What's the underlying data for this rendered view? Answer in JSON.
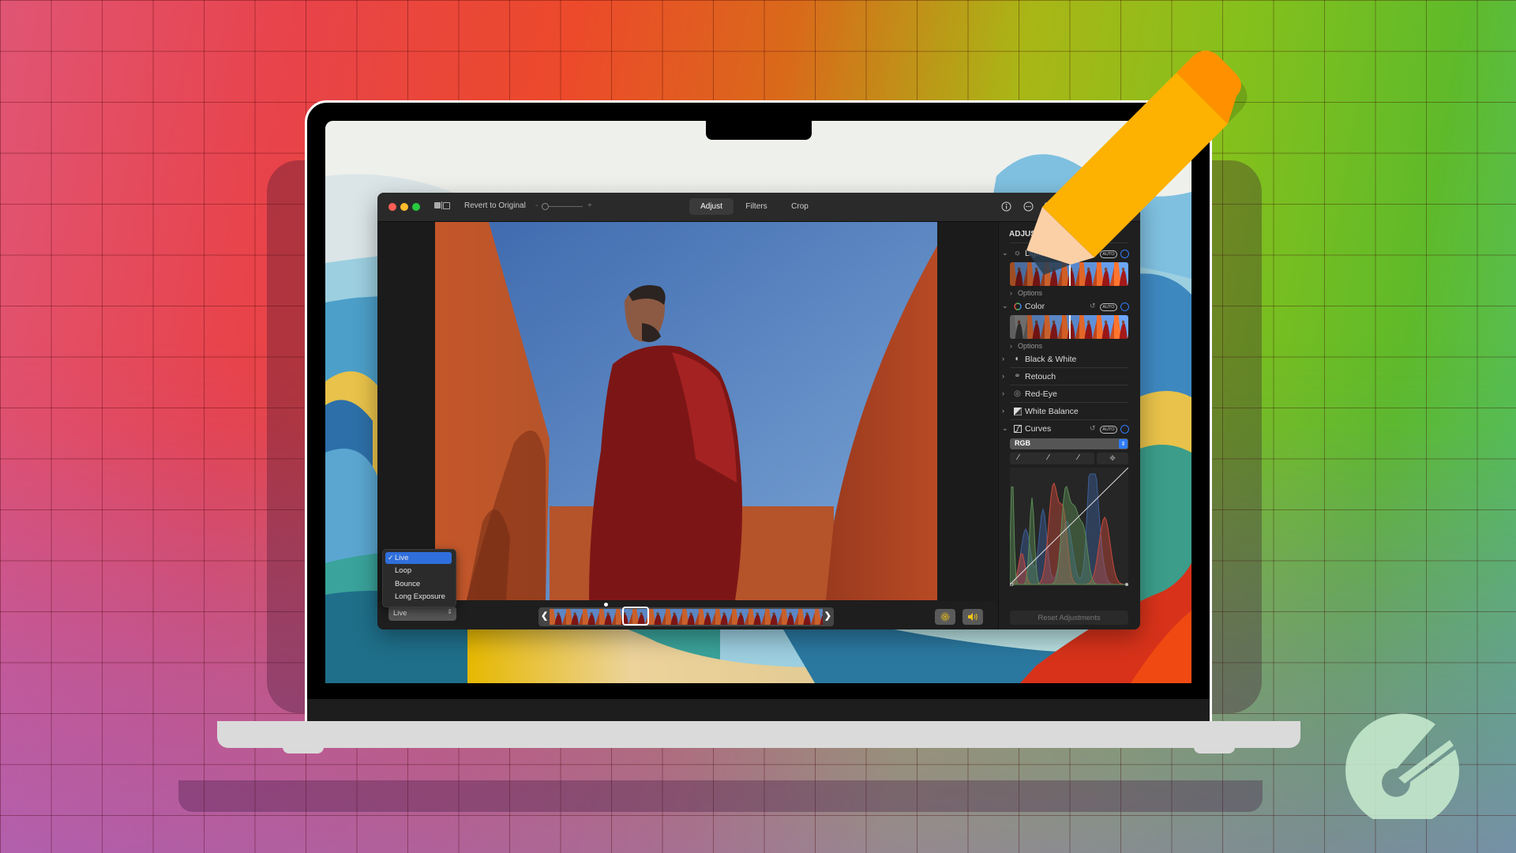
{
  "window": {
    "revert_label": "Revert to Original",
    "zoom_minus": "-",
    "zoom_plus": "+",
    "tabs": [
      {
        "label": "Adjust",
        "active": true
      },
      {
        "label": "Filters",
        "active": false
      },
      {
        "label": "Crop",
        "active": false
      }
    ],
    "toolbar_icons": [
      "info-icon",
      "more-icon",
      "heart-icon"
    ]
  },
  "adjust_panel": {
    "title": "ADJUST",
    "sections": [
      {
        "label": "Light",
        "expanded": true,
        "icon": "sun-icon",
        "has_auto": true,
        "options_label": "Options"
      },
      {
        "label": "Color",
        "expanded": true,
        "icon": "color-wheel-icon",
        "has_auto": true,
        "options_label": "Options"
      },
      {
        "label": "Black & White",
        "expanded": false,
        "icon": "half-circle-icon"
      },
      {
        "label": "Retouch",
        "expanded": false,
        "icon": "bandage-icon"
      },
      {
        "label": "Red-Eye",
        "expanded": false,
        "icon": "eye-icon"
      },
      {
        "label": "White Balance",
        "expanded": false,
        "icon": "white-balance-icon"
      },
      {
        "label": "Curves",
        "expanded": true,
        "icon": "curves-icon",
        "has_auto": true
      }
    ],
    "auto_label": "AUTO",
    "curves_channel": "RGB",
    "reset_label": "Reset Adjustments"
  },
  "live_menu": {
    "options": [
      "Live",
      "Loop",
      "Bounce",
      "Long Exposure"
    ],
    "selected": "Live",
    "checkmark": "✓"
  },
  "live_select_value": "Live",
  "colors": {
    "accent_blue": "#2f7cf6",
    "pencil_body": "#fdb100",
    "pencil_eraser": "#ff9100",
    "live_icon_yellow": "#f2c318"
  }
}
